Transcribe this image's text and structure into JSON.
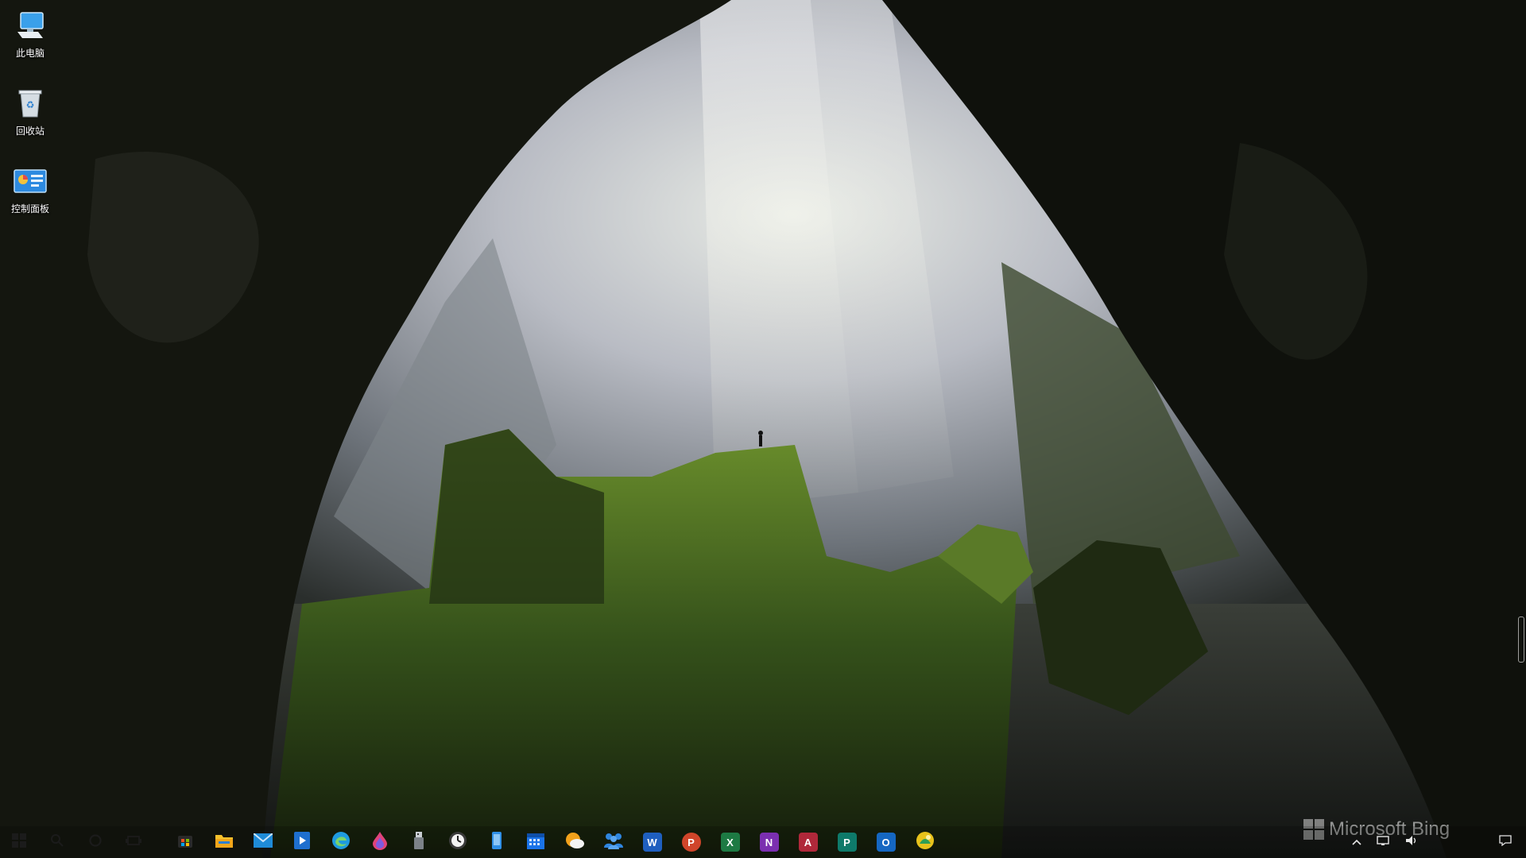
{
  "desktop": {
    "icons": [
      {
        "label": "此电脑",
        "icon": "this-pc-icon"
      },
      {
        "label": "回收站",
        "icon": "recycle-bin-icon"
      },
      {
        "label": "控制面板",
        "icon": "control-panel-icon"
      }
    ]
  },
  "taskbar": {
    "left": [
      {
        "icon": "start-icon"
      },
      {
        "icon": "search-icon"
      },
      {
        "icon": "cortana-icon"
      },
      {
        "icon": "task-view-icon"
      }
    ],
    "apps": [
      {
        "icon": "store-icon",
        "color": "#2b2b2b",
        "glyph": "▦"
      },
      {
        "icon": "file-explorer-icon",
        "color": "#f3b31b",
        "glyph": ""
      },
      {
        "icon": "mail-icon",
        "color": "#1f8bd8",
        "glyph": "✉"
      },
      {
        "icon": "movies-tv-icon",
        "color": "#1e6fcf",
        "glyph": "▶"
      },
      {
        "icon": "edge-icon",
        "color": "#1f9be0",
        "glyph": "e"
      },
      {
        "icon": "paint-icon",
        "color": "#e0437a",
        "glyph": "●"
      },
      {
        "icon": "usb-icon",
        "color": "#9aa0a6",
        "glyph": "▮"
      },
      {
        "icon": "clock-icon",
        "color": "#f0f0f0",
        "glyph": "◷"
      },
      {
        "icon": "phone-icon",
        "color": "#2f8fe6",
        "glyph": "▯"
      },
      {
        "icon": "calendar-icon",
        "color": "#1a73e8",
        "glyph": "▦"
      },
      {
        "icon": "weather-icon",
        "color": "#f3a21b",
        "glyph": "☁"
      },
      {
        "icon": "people-icon",
        "color": "#2f86e0",
        "glyph": "👥"
      },
      {
        "icon": "word-icon",
        "color": "#1f5fbf",
        "glyph": "W"
      },
      {
        "icon": "powerpoint-icon",
        "color": "#d0452a",
        "glyph": "P"
      },
      {
        "icon": "excel-icon",
        "color": "#1d7a43",
        "glyph": "X"
      },
      {
        "icon": "onenote-icon",
        "color": "#7b2fb0",
        "glyph": "N"
      },
      {
        "icon": "access-icon",
        "color": "#b0283a",
        "glyph": "A"
      },
      {
        "icon": "publisher-icon",
        "color": "#0e7a6a",
        "glyph": "P"
      },
      {
        "icon": "outlook-icon",
        "color": "#1567c2",
        "glyph": "O"
      },
      {
        "icon": "photos-icon",
        "color": "#e8c21b",
        "glyph": "◉"
      }
    ],
    "bing_watermark": "Microsoft Bing"
  }
}
